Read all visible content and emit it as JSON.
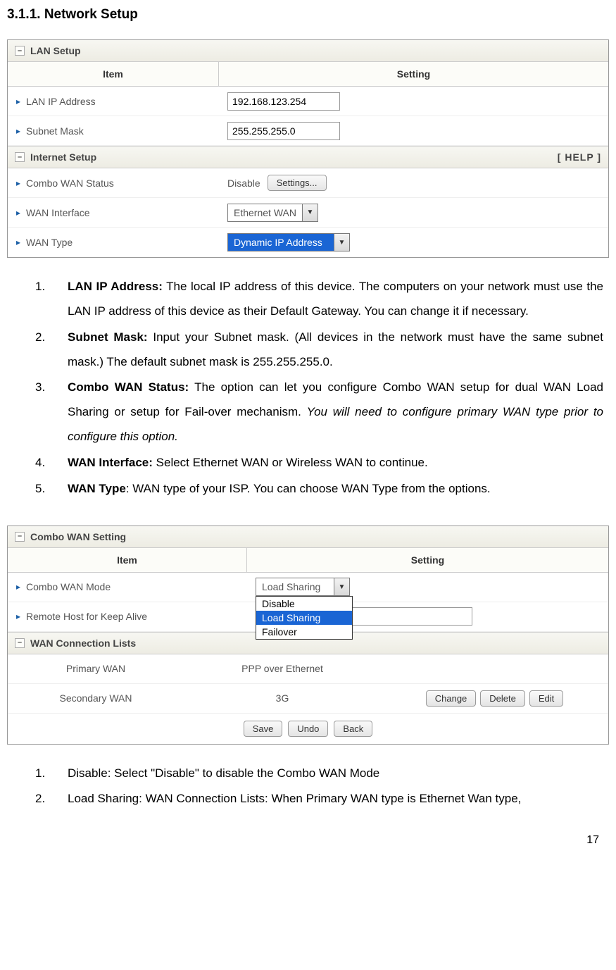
{
  "heading": "3.1.1. Network Setup",
  "panel1": {
    "lan_setup_title": "LAN Setup",
    "hdr_item": "Item",
    "hdr_setting": "Setting",
    "lan_ip_label": "LAN IP Address",
    "lan_ip_value": "192.168.123.254",
    "subnet_label": "Subnet Mask",
    "subnet_value": "255.255.255.0",
    "internet_setup_title": "Internet Setup",
    "help_text": "[ HELP ]",
    "combo_wan_status_label": "Combo WAN Status",
    "combo_wan_status_text": "Disable",
    "settings_btn": "Settings...",
    "wan_interface_label": "WAN Interface",
    "wan_interface_value": "Ethernet WAN",
    "wan_type_label": "WAN Type",
    "wan_type_value": "Dynamic IP Address"
  },
  "list1": {
    "i1n": "1.",
    "i1b": "LAN IP Address:",
    "i1t": " The local IP address of this device. The computers on your network must use the LAN IP address of this device as their Default Gateway. You can change it if necessary.",
    "i2n": "2.",
    "i2b": "Subnet Mask:",
    "i2t": " Input your Subnet mask. (All devices in the network must have the same subnet mask.) The default subnet mask is 255.255.255.0.",
    "i3n": "3.",
    "i3b": "Combo WAN Status:",
    "i3t1": " The option can let you configure Combo WAN setup for dual WAN Load Sharing or setup for Fail-over mechanism. ",
    "i3i": "You will need to configure primary WAN type prior to configure this option.",
    "i4n": "4.",
    "i4b": "WAN Interface:",
    "i4t": " Select Ethernet WAN or Wireless WAN to continue.",
    "i5n": "5.",
    "i5b": "WAN Type",
    "i5t": ": WAN type of your ISP. You can choose WAN Type from the options."
  },
  "panel2": {
    "combo_title": "Combo WAN Setting",
    "hdr_item": "Item",
    "hdr_setting": "Setting",
    "mode_label": "Combo WAN Mode",
    "mode_value": "Load Sharing",
    "mode_opts": {
      "o1": "Disable",
      "o2": "Load Sharing",
      "o3": "Failover"
    },
    "remote_label": "Remote Host for Keep Alive",
    "conn_title": "WAN Connection Lists",
    "primary_label": "Primary WAN",
    "primary_value": "PPP over Ethernet",
    "secondary_label": "Secondary WAN",
    "secondary_value": "3G",
    "change_btn": "Change",
    "delete_btn": "Delete",
    "edit_btn": "Edit",
    "save_btn": "Save",
    "undo_btn": "Undo",
    "back_btn": "Back"
  },
  "list2": {
    "i1n": "1.",
    "i1t": "Disable: Select \"Disable\" to disable the Combo WAN Mode",
    "i2n": "2.",
    "i2t": "Load Sharing: WAN Connection Lists: When Primary WAN type is Ethernet Wan type,"
  },
  "page_number": "17"
}
